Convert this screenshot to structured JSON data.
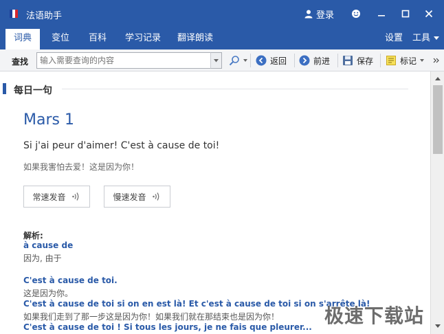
{
  "window": {
    "title": "法语助手",
    "login_label": "登录",
    "icons": {
      "logo": "french-flag-logo",
      "login": "user-icon",
      "skin": "smiley-icon",
      "minimize": "minimize-icon",
      "maximize": "maximize-icon",
      "close": "close-icon"
    }
  },
  "tabs": [
    {
      "label": "词典",
      "active": true
    },
    {
      "label": "变位",
      "active": false
    },
    {
      "label": "百科",
      "active": false
    },
    {
      "label": "学习记录",
      "active": false
    },
    {
      "label": "翻译朗读",
      "active": false
    }
  ],
  "tabbar_right": {
    "settings_label": "设置",
    "tools_label": "工具"
  },
  "toolbar": {
    "search_label": "查找",
    "search_placeholder": "输入需要查询的内容",
    "back_label": "返回",
    "forward_label": "前进",
    "save_label": "保存",
    "bookmark_label": "标记"
  },
  "content": {
    "section_title": "每日一句",
    "date": "Mars 1",
    "sentence_fr": "Si j'ai peur d'aimer! C'est à cause de toi!",
    "sentence_zh": "如果我害怕去爱！这是因为你！",
    "normal_speed_label": "常速发音",
    "slow_speed_label": "慢速发音",
    "analysis_label": "解析:",
    "analysis": [
      {
        "fr": "à cause de",
        "zh": "因为, 由于"
      },
      {
        "fr": "C'est à cause de toi.",
        "zh": "这是因为你。"
      },
      {
        "fr": "C'est à cause de toi si on en est là! Et c'est à cause de toi si on s'arrête là!",
        "zh": "如果我们走到了那一步这是因为你！如果我们就在那结束也是因为你！"
      },
      {
        "fr": "C'est à cause de toi ! Si tous les jours, je ne fais que pleurer...",
        "zh": ""
      }
    ]
  },
  "watermark": "极速下载站",
  "colors": {
    "accent": "#2a5aa8",
    "toolbar_bg": "#f3f4f6"
  }
}
